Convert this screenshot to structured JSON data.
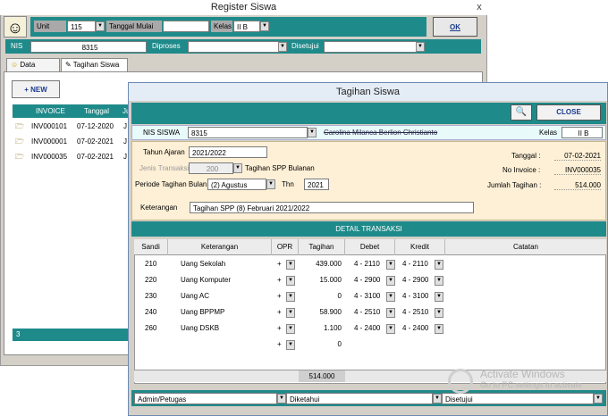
{
  "register": {
    "title": "Register Siswa",
    "close_glyph": "x",
    "unit_label": "Unit",
    "unit_value": "115",
    "tanggal_mulai_label": "Tanggal Mulai",
    "tanggal_mulai_value": "",
    "kelas_label": "Kelas",
    "kelas_value": "II B",
    "ok_label": "OK",
    "nis_label": "NIS",
    "nis_value": "8315",
    "diproses_label": "Diproses",
    "disetujui_label": "Disetujui",
    "tabs": [
      {
        "label": "Data Siswa",
        "icon": "smiley-icon"
      },
      {
        "label": "Tagihan Siswa",
        "icon": "money-icon"
      }
    ],
    "new_label": "+ NEW",
    "grid_headers": [
      "INVOICE",
      "Tanggal",
      "Ju"
    ],
    "grid_rows": [
      {
        "invoice": "INV000101",
        "tanggal": "07-12-2020",
        "ju": "J"
      },
      {
        "invoice": "INV000001",
        "tanggal": "07-02-2021",
        "ju": "J"
      },
      {
        "invoice": "INV000035",
        "tanggal": "07-02-2021",
        "ju": "J"
      }
    ],
    "grid_count": "3"
  },
  "tagihan": {
    "title": "Tagihan Siswa",
    "close_label": "CLOSE",
    "nis_siswa_label": "NIS SISWA",
    "nis_siswa_value": "8315",
    "student_name": "Carolina Milanca Berlion Christianto",
    "kelas_label": "Kelas",
    "kelas_value": "II B",
    "tahun_ajaran_label": "Tahun Ajaran",
    "tahun_ajaran_value": "2021/2022",
    "jenis_transaksi_label": "Jenis Transaksi",
    "jenis_transaksi_value": "200",
    "jenis_transaksi_desc": "Tagihan SPP Bulanan",
    "periode_label": "Periode Tagihan Bulan",
    "periode_value": "(2) Agustus",
    "thn_label": "Thn",
    "thn_value": "2021",
    "keterangan_label": "Keterangan",
    "keterangan_value": "Tagihan SPP (8) Februari 2021/2022",
    "tanggal_label": "Tanggal :",
    "tanggal_value": "07-02-2021",
    "no_invoice_label": "No Invoice :",
    "no_invoice_value": "INV000035",
    "jumlah_label": "Jumlah Tagihan :",
    "jumlah_value": "514.000",
    "detail_title": "DETAIL TRANSAKSI",
    "columns": [
      "Sandi",
      "Keterangan",
      "OPR",
      "Tagihan",
      "Debet",
      "Kredit",
      "Catatan"
    ],
    "rows": [
      {
        "sandi": "210",
        "keterangan": "Uang Sekolah",
        "opr": "+",
        "tagihan": "439.000",
        "debet": "4 - 2110",
        "kredit": "4 - 2110"
      },
      {
        "sandi": "220",
        "keterangan": "Uang Komputer",
        "opr": "+",
        "tagihan": "15.000",
        "debet": "4 - 2900",
        "kredit": "4 - 2900"
      },
      {
        "sandi": "230",
        "keterangan": "Uang AC",
        "opr": "+",
        "tagihan": "0",
        "debet": "4 - 3100",
        "kredit": "4 - 3100"
      },
      {
        "sandi": "240",
        "keterangan": "Uang BPPMP",
        "opr": "+",
        "tagihan": "58.900",
        "debet": "4 - 2510",
        "kredit": "4 - 2510"
      },
      {
        "sandi": "260",
        "keterangan": "Uang DSKB",
        "opr": "+",
        "tagihan": "1.100",
        "debet": "4 - 2400",
        "kredit": "4 - 2400"
      },
      {
        "sandi": "",
        "keterangan": "",
        "opr": "+",
        "tagihan": "0",
        "debet": "",
        "kredit": ""
      }
    ],
    "total": "514.000",
    "admin_label": "Admin/Petugas",
    "diketahui_label": "Diketahui",
    "disetujui_label": "Disetujui"
  },
  "watermark": {
    "line1": "Activate Windows",
    "line2": "Go to PC settings to activate"
  },
  "colors": {
    "teal": "#1f8a8a",
    "cream": "#fdf0d6",
    "window": "#d4d0c8"
  }
}
